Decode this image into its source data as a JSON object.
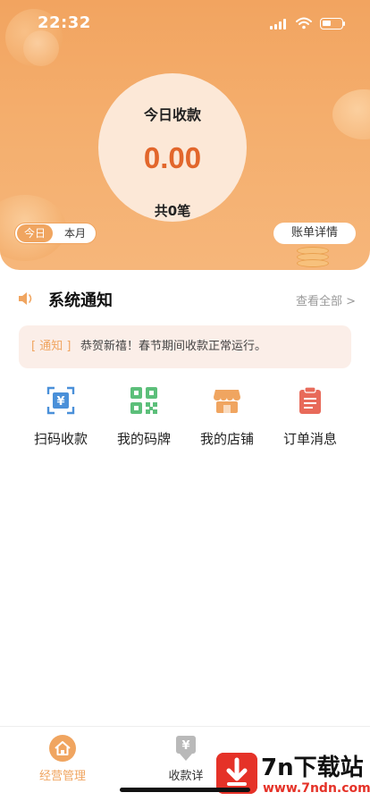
{
  "status_bar": {
    "time": "22:32"
  },
  "summary": {
    "title": "今日收款",
    "amount": "0.00",
    "count_text": "共0笔",
    "period_tabs": {
      "today": "今日",
      "month": "本月"
    },
    "bill_details_label": "账单详情"
  },
  "notice": {
    "title": "系统通知",
    "view_all": "查看全部 >",
    "tag": "[ 通知 ]",
    "message": "恭贺新禧！春节期间收款正常运行。"
  },
  "actions": [
    {
      "label": "扫码收款",
      "icon": "scan-pay-icon",
      "color": "#4a90d9"
    },
    {
      "label": "我的码牌",
      "icon": "qrcode-icon",
      "color": "#5cbf7a"
    },
    {
      "label": "我的店铺",
      "icon": "store-icon",
      "color": "#f0a560"
    },
    {
      "label": "订单消息",
      "icon": "order-icon",
      "color": "#e86a5a"
    }
  ],
  "tabbar": {
    "items": [
      {
        "label": "经营管理",
        "icon": "home-icon",
        "active": true
      },
      {
        "label": "收款详",
        "icon": "receipt-icon",
        "active": false
      }
    ]
  },
  "watermark": {
    "brand": "7n下载站",
    "url": "www.7ndn.com"
  },
  "colors": {
    "accent": "#f0a560",
    "amount": "#e2662b",
    "notice_bg": "#fbeee8"
  }
}
